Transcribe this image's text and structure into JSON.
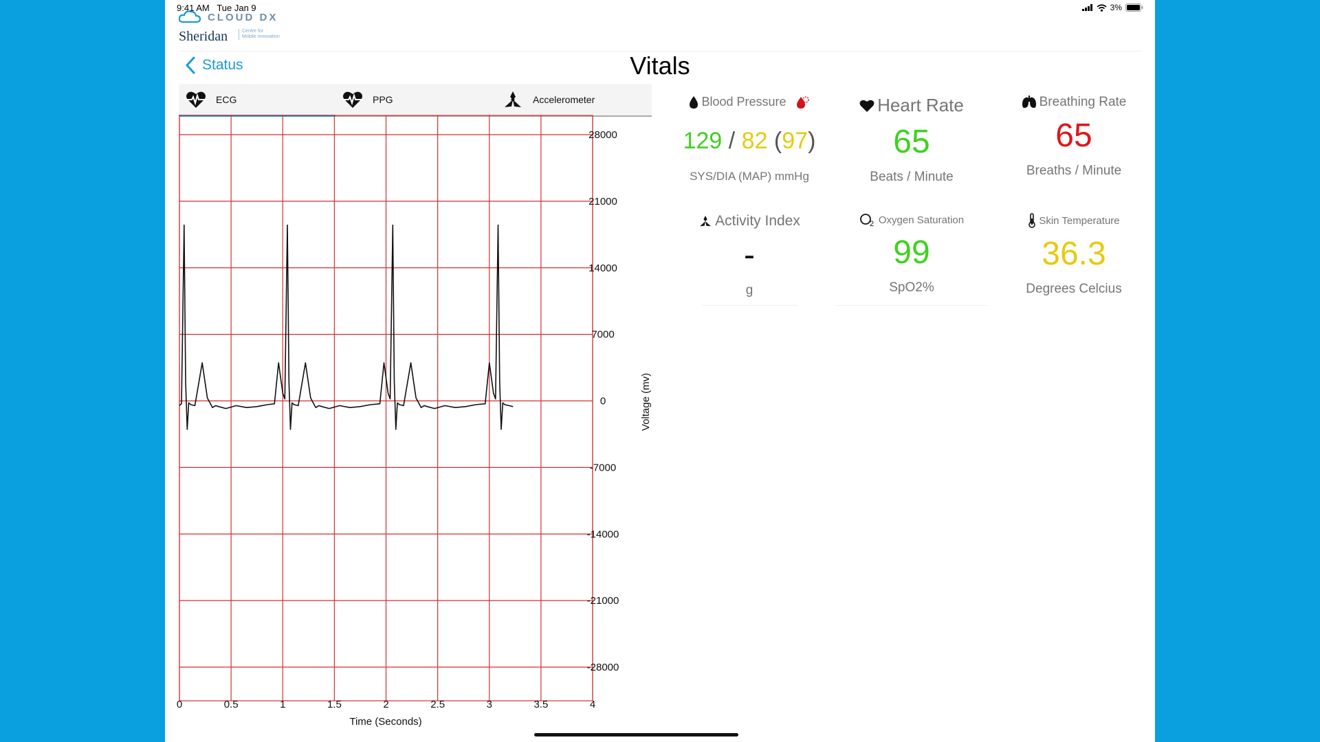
{
  "status_bar": {
    "time": "9:41 AM",
    "date": "Tue Jan 9",
    "battery": "3%"
  },
  "logo": {
    "cloud_text": "CLOUD DX",
    "sheridan": "Sheridan",
    "sub_line1": "Centre for",
    "sub_line2": "Mobile Innovation"
  },
  "nav": {
    "back_label": "Status",
    "title": "Vitals"
  },
  "tabs": [
    {
      "label": "ECG",
      "icon": "heart-pulse-icon",
      "active": true
    },
    {
      "label": "PPG",
      "icon": "heart-pulse-icon",
      "active": false
    },
    {
      "label": "Accelerometer",
      "icon": "accelerometer-icon",
      "active": false
    }
  ],
  "chart_data": {
    "type": "line",
    "xlabel": "Time (Seconds)",
    "ylabel": "Voltage (mv)",
    "xlim": [
      0,
      4
    ],
    "ylim": [
      -28000,
      28000
    ],
    "x_ticks": [
      "0",
      "0.5",
      "1",
      "1.5",
      "2",
      "2.5",
      "3",
      "3.5",
      "4"
    ],
    "y_ticks": [
      "28000",
      "21000",
      "14000",
      "7000",
      "0",
      "-7000",
      "-14000",
      "-21000",
      "-28000"
    ],
    "grid": true,
    "grid_color": "#d32f2f",
    "line_color": "#111111",
    "series": [
      {
        "x": [
          0,
          0.02,
          0.045,
          0.06,
          0.075,
          0.09,
          0.11,
          0.15,
          0.22,
          0.27,
          0.32,
          0.35,
          0.38,
          0.45,
          0.55,
          0.65,
          0.75,
          0.85,
          0.92,
          0.96,
          1.0,
          1.02,
          1.045,
          1.06,
          1.075,
          1.09,
          1.11,
          1.15,
          1.22,
          1.27,
          1.32,
          1.35,
          1.38,
          1.45,
          1.55,
          1.65,
          1.75,
          1.85,
          1.94,
          1.98,
          2.02,
          2.04,
          2.065,
          2.08,
          2.095,
          2.11,
          2.13,
          2.17,
          2.24,
          2.29,
          2.34,
          2.37,
          2.4,
          2.47,
          2.57,
          2.67,
          2.77,
          2.87,
          2.96,
          3.0,
          3.04,
          3.06,
          3.085,
          3.1,
          3.115,
          3.13,
          3.15,
          3.19,
          3.23
        ],
        "y": [
          -500,
          -300,
          18500,
          2000,
          -3000,
          -200,
          -400,
          -500,
          4000,
          300,
          -700,
          -500,
          -600,
          -800,
          -500,
          -700,
          -600,
          -400,
          -300,
          4000,
          800,
          200,
          18500,
          2000,
          -3000,
          -200,
          -400,
          -500,
          4000,
          300,
          -700,
          -500,
          -600,
          -800,
          -500,
          -700,
          -600,
          -400,
          -300,
          4000,
          800,
          200,
          18500,
          2000,
          -3000,
          -200,
          -400,
          -500,
          4000,
          300,
          -700,
          -500,
          -600,
          -800,
          -500,
          -700,
          -600,
          -400,
          -300,
          4000,
          800,
          200,
          18500,
          2000,
          -3000,
          -200,
          -400,
          -500,
          -600
        ]
      }
    ]
  },
  "vitals": {
    "blood_pressure": {
      "title": "Blood Pressure",
      "sys": "129",
      "sep": " / ",
      "dia": "82",
      "map_open": " (",
      "map": "97",
      "map_close": ")",
      "unit": "SYS/DIA (MAP) mmHg",
      "sys_color": "#3ed21f",
      "dia_color": "#e5cb10",
      "map_color": "#e5cb10"
    },
    "heart_rate": {
      "title": "Heart Rate",
      "value": "65",
      "unit": "Beats / Minute",
      "color": "#3ed21f"
    },
    "breathing_rate": {
      "title": "Breathing Rate",
      "value": "65",
      "unit": "Breaths / Minute",
      "color": "#e0151b"
    },
    "activity_index": {
      "title": "Activity Index",
      "value": "-",
      "unit": "g",
      "color": "#111111"
    },
    "oxygen_saturation": {
      "title": "Oxygen Saturation",
      "value": "99",
      "unit": "SpO2%",
      "color": "#3ed21f"
    },
    "skin_temperature": {
      "title": "Skin Temperature",
      "value": "36.3",
      "unit": "Degrees Celcius",
      "color": "#e5cb10"
    }
  }
}
